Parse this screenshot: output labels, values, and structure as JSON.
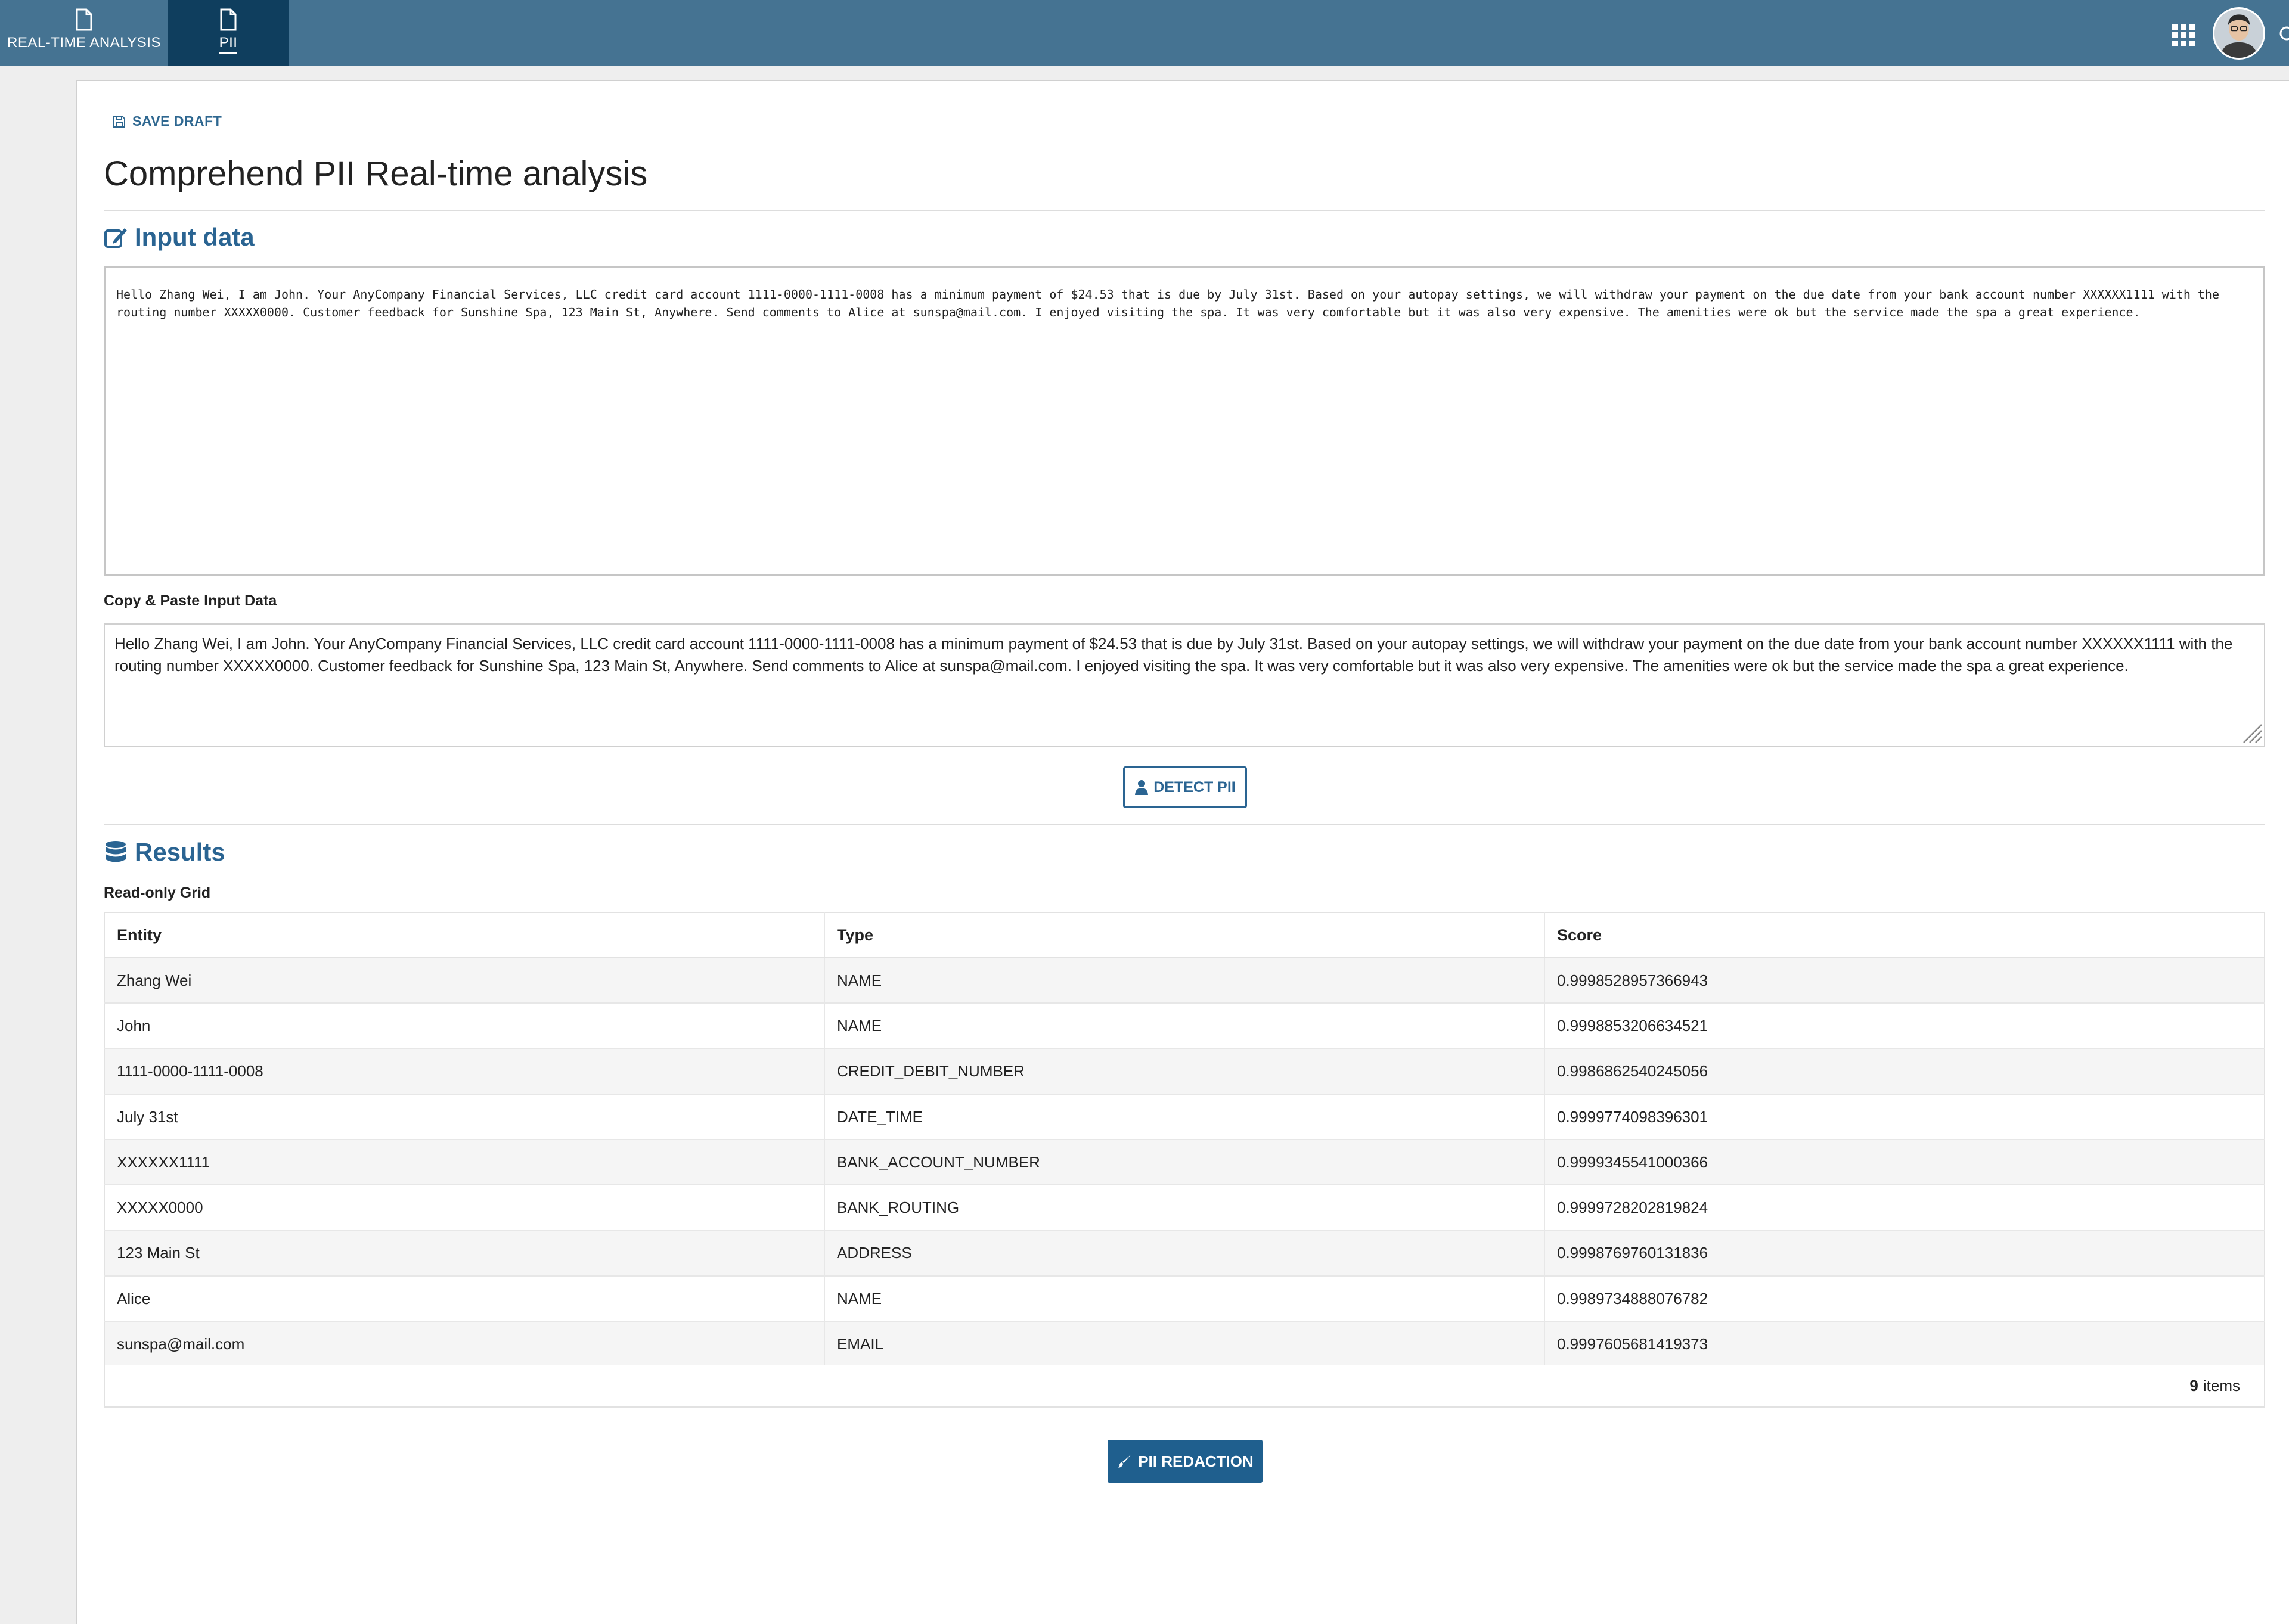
{
  "tabs": [
    {
      "label": "REAL-TIME ANALYSIS",
      "icon": "document-icon",
      "active": false
    },
    {
      "label": "PII",
      "icon": "document-icon",
      "active": true
    }
  ],
  "toolbar": {
    "save_draft_label": "SAVE DRAFT"
  },
  "page": {
    "title": "Comprehend PII Real-time analysis"
  },
  "input_section": {
    "title": "Input data",
    "icon": "edit-icon",
    "text": "Hello Zhang Wei, I am John. Your AnyCompany Financial Services, LLC credit card account 1111-0000-1111-0008 has a minimum payment of $24.53 that is due by July 31st. Based on your autopay settings, we will withdraw your payment on the due date from your bank account number XXXXXX1111 with the routing number XXXXX0000. Customer feedback for Sunshine Spa, 123 Main St, Anywhere. Send comments to Alice at sunspa@mail.com. I enjoyed visiting the spa. It was very comfortable but it was also very expensive. The amenities were ok but the service made the spa a great experience.",
    "paste_label": "Copy & Paste Input Data",
    "paste_value": "Hello Zhang Wei, I am John. Your AnyCompany Financial Services, LLC credit card account 1111-0000-1111-0008 has a minimum payment of $24.53 that is due by July 31st. Based on your autopay settings, we will withdraw your payment on the due date from your bank account number XXXXXX1111 with the routing number XXXXX0000. Customer feedback for Sunshine Spa, 123 Main St, Anywhere. Send comments to Alice at sunspa@mail.com. I enjoyed visiting the spa. It was very comfortable but it was also very expensive. The amenities were ok but the service made the spa a great experience.",
    "detect_button": "DETECT PII"
  },
  "results": {
    "title": "Results",
    "icon": "database-icon",
    "grid_label": "Read-only Grid",
    "columns": [
      "Entity",
      "Type",
      "Score"
    ],
    "rows": [
      [
        "Zhang Wei",
        "NAME",
        "0.9998528957366943"
      ],
      [
        "John",
        "NAME",
        "0.9998853206634521"
      ],
      [
        "1111-0000-1111-0008",
        "CREDIT_DEBIT_NUMBER",
        "0.9986862540245056"
      ],
      [
        "July 31st",
        "DATE_TIME",
        "0.9999774098396301"
      ],
      [
        "XXXXXX1111",
        "BANK_ACCOUNT_NUMBER",
        "0.9999345541000366"
      ],
      [
        "XXXXX0000",
        "BANK_ROUTING",
        "0.9999728202819824"
      ],
      [
        "123 Main St",
        "ADDRESS",
        "0.9998769760131836"
      ],
      [
        "Alice",
        "NAME",
        "0.9989734888076782"
      ],
      [
        "sunspa@mail.com",
        "EMAIL",
        "0.9997605681419373"
      ]
    ],
    "footer_count": "9",
    "footer_suffix": "items",
    "redaction_button": "PII REDACTION"
  },
  "colors": {
    "topbar": "#457392",
    "active_tab": "#0f3e5e",
    "accent": "#2a6492",
    "primary_button": "#1f5f8e"
  }
}
